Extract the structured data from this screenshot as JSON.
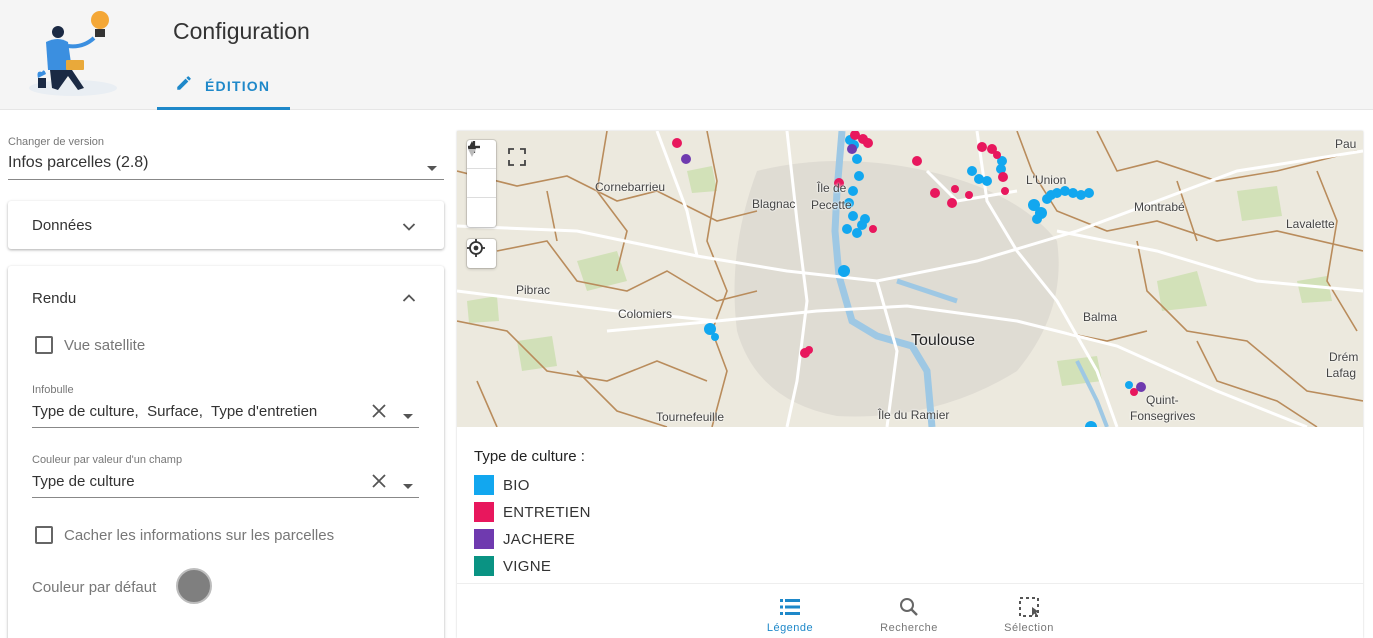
{
  "header": {
    "title": "Configuration",
    "tab_label": "ÉDITION"
  },
  "version": {
    "label": "Changer de version",
    "value": "Infos parcelles (2.8)"
  },
  "donnees": {
    "title": "Données"
  },
  "rendu": {
    "title": "Rendu",
    "vue_satellite": "Vue satellite",
    "infobulle_label": "Infobulle",
    "infobulle_value": "Type de culture,  Surface,  Type d'entretien",
    "couleur_champ_label": "Couleur par valeur d'un champ",
    "couleur_champ_value": "Type de culture",
    "cacher_info": "Cacher les informations sur les parcelles",
    "couleur_defaut": "Couleur par défaut",
    "couleur_defaut_hex": "#7f7f7f"
  },
  "map": {
    "labels": {
      "cornebarrieu": "Cornebarrieu",
      "blagnac": "Blagnac",
      "ile_de": "Île de",
      "pecette": "Pecette",
      "lunion": "L'Union",
      "montrabe": "Montrabé",
      "lavalette": "Lavalette",
      "pau": "Pau",
      "pibrac": "Pibrac",
      "colomiers": "Colomiers",
      "toulouse": "Toulouse",
      "balma": "Balma",
      "drem": "Drém",
      "lafag": "Lafag",
      "quint": "Quint-",
      "fonsegrives": "Fonsegrives",
      "tournefeuille": "Tournefeuille",
      "ile_ramier": "Île du Ramier"
    }
  },
  "legend": {
    "title": "Type de culture :",
    "items": [
      {
        "label": "BIO",
        "color": "#12a7ef"
      },
      {
        "label": "ENTRETIEN",
        "color": "#e8175d"
      },
      {
        "label": "JACHERE",
        "color": "#6f3aaf"
      },
      {
        "label": "VIGNE",
        "color": "#0a9383"
      }
    ]
  },
  "bottom_nav": {
    "legende": "Légende",
    "recherche": "Recherche",
    "selection": "Sélection"
  },
  "colors": {
    "accent": "#1e88c9",
    "bio": "#12a7ef",
    "entretien": "#e8175d",
    "jachere": "#6f3aaf",
    "vigne": "#0a9383"
  }
}
